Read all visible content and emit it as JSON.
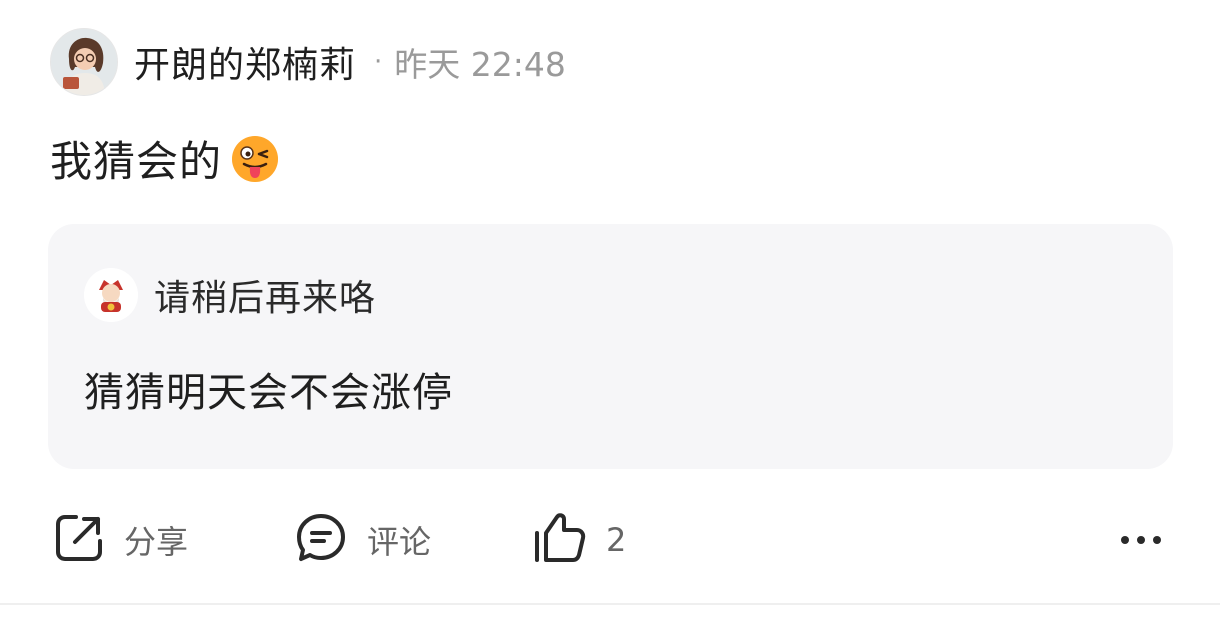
{
  "post": {
    "author": "开朗的郑楠莉",
    "separator": "·",
    "time": "昨天 22:48",
    "content": "我猜会的",
    "content_emoji": "winking-face-with-tongue-emoji"
  },
  "quote": {
    "author": "请稍后再来咯",
    "text": "猜猜明天会不会涨停"
  },
  "actions": {
    "share_label": "分享",
    "comment_label": "评论",
    "like_count": "2",
    "share_icon": "share-icon",
    "comment_icon": "comment-icon",
    "like_icon": "thumbs-up-icon",
    "more_icon": "more-icon"
  },
  "colors": {
    "background": "#ffffff",
    "quote_background": "#f6f6f8",
    "primary_text": "#1f1f1f",
    "secondary_text": "#9a9a9a",
    "action_text": "#666666"
  }
}
